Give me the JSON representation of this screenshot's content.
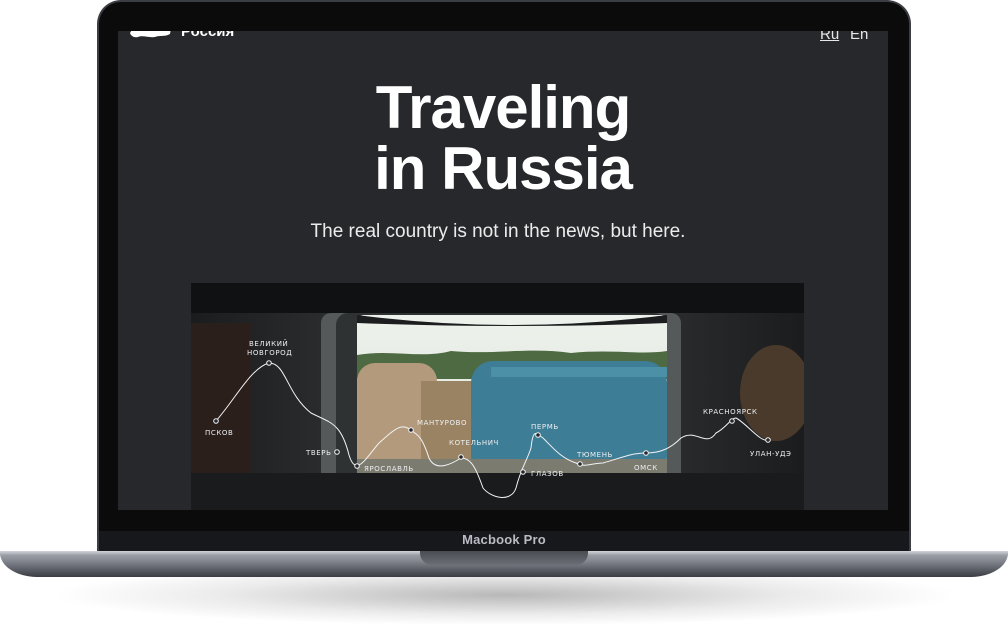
{
  "device": {
    "label": "Macbook Pro"
  },
  "header": {
    "logo_text": "Россия",
    "languages": [
      {
        "label": "Ru",
        "active": true
      },
      {
        "label": "En",
        "active": false
      }
    ]
  },
  "hero": {
    "title_line1": "Traveling",
    "title_line2": "in Russia",
    "subtitle": "The real country is not in the news, but here."
  },
  "route_map": {
    "cities": [
      {
        "name": "ПСКОВ"
      },
      {
        "name": "ВЕЛИКИЙ"
      },
      {
        "name": "НОВГОРОД"
      },
      {
        "name": "ТВЕРЬ"
      },
      {
        "name": "ЯРОСЛАВЛЬ"
      },
      {
        "name": "МАНТУРОВО"
      },
      {
        "name": "КОТЕЛЬНИЧ"
      },
      {
        "name": "ГЛАЗОВ"
      },
      {
        "name": "ПЕРМЬ"
      },
      {
        "name": "ТЮМЕНЬ"
      },
      {
        "name": "ОМСК"
      },
      {
        "name": "КРАСНОЯРСК"
      },
      {
        "name": "УЛАН-УДЭ"
      }
    ]
  },
  "colors": {
    "screen_bg": "#27282c",
    "text": "#ffffff"
  }
}
